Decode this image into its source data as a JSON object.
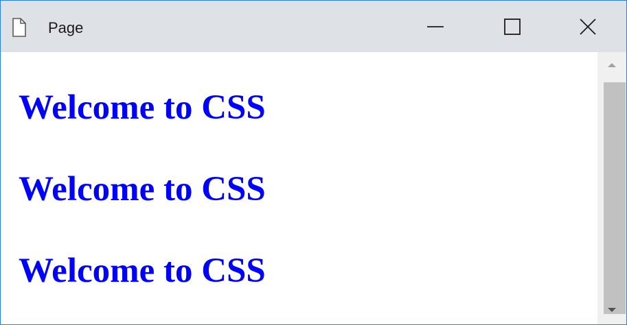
{
  "window": {
    "title": "Page",
    "icon": "page-icon",
    "controls": {
      "minimize_icon": "minimize-icon",
      "maximize_icon": "maximize-icon",
      "close_icon": "close-icon"
    }
  },
  "content": {
    "headings": [
      "Welcome to CSS",
      "Welcome to CSS",
      "Welcome to CSS"
    ],
    "heading_color": "#0000ff"
  },
  "scrollbar": {
    "up_icon": "scroll-up-arrow-icon",
    "down_icon": "scroll-down-arrow-icon"
  },
  "colors": {
    "titlebar": "#dee1e6",
    "window_border": "#2b7fd8",
    "scroll_thumb": "#c1c1c1",
    "scroll_track": "#f0f0f0"
  }
}
